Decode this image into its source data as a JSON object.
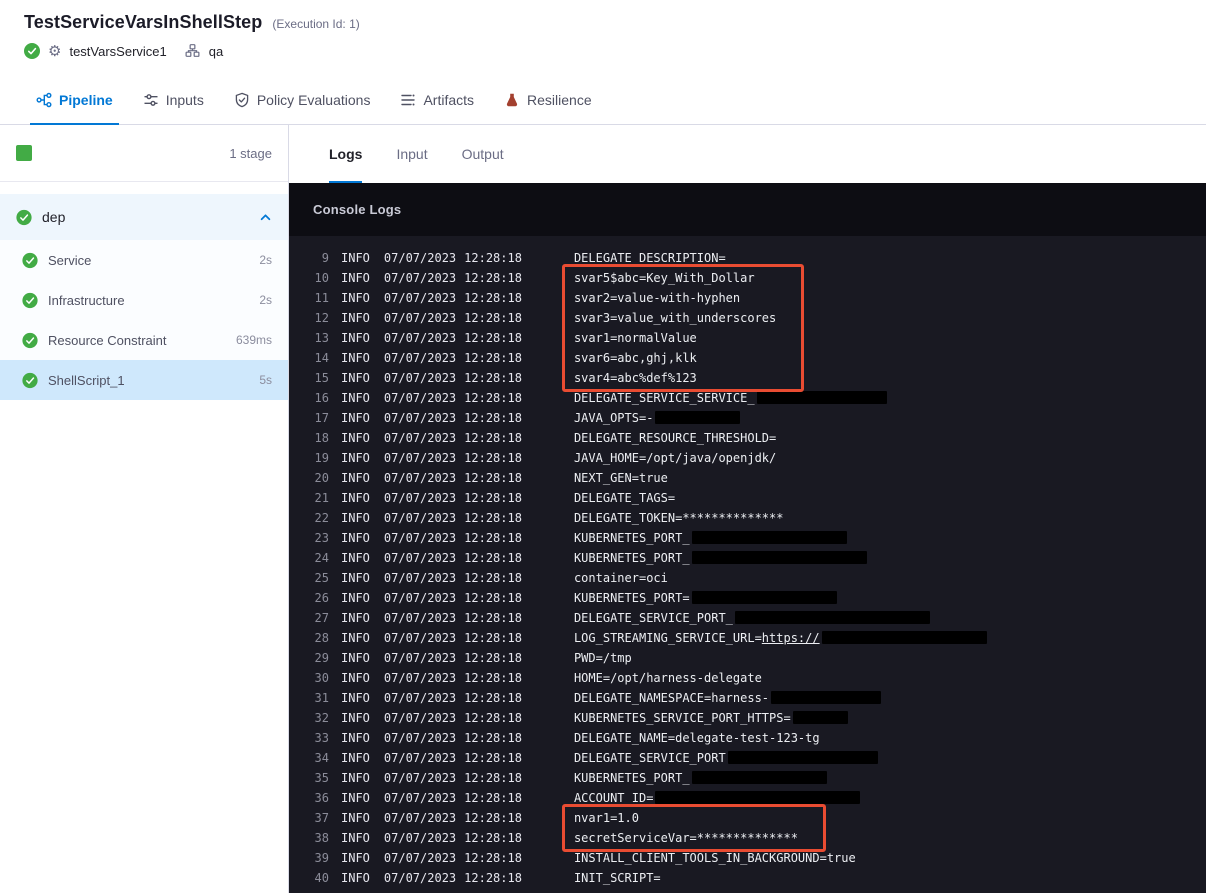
{
  "header": {
    "title": "TestServiceVarsInShellStep",
    "execution_id": "(Execution Id: 1)",
    "service_label": "testVarsService1",
    "env_label": "qa"
  },
  "nav_tabs": [
    {
      "label": "Pipeline",
      "icon": "pipeline-icon",
      "active": true
    },
    {
      "label": "Inputs",
      "icon": "inputs-icon",
      "active": false
    },
    {
      "label": "Policy Evaluations",
      "icon": "policy-icon",
      "active": false
    },
    {
      "label": "Artifacts",
      "icon": "artifacts-icon",
      "active": false
    },
    {
      "label": "Resilience",
      "icon": "resilience-icon",
      "active": false
    }
  ],
  "sidebar": {
    "stage_count_label": "1 stage",
    "stage_name": "dep",
    "steps": [
      {
        "name": "Service",
        "duration": "2s",
        "selected": false
      },
      {
        "name": "Infrastructure",
        "duration": "2s",
        "selected": false
      },
      {
        "name": "Resource Constraint",
        "duration": "639ms",
        "selected": false
      },
      {
        "name": "ShellScript_1",
        "duration": "5s",
        "selected": true
      }
    ]
  },
  "console": {
    "tabs": [
      {
        "label": "Logs",
        "active": true
      },
      {
        "label": "Input",
        "active": false
      },
      {
        "label": "Output",
        "active": false
      }
    ],
    "panel_title": "Console Logs",
    "log_level": "INFO",
    "log_date": "07/07/2023",
    "log_time": "12:28:18",
    "highlight_color": "#e94c32",
    "highlights": [
      {
        "from": 10,
        "to": 15
      },
      {
        "from": 37,
        "to": 38
      }
    ],
    "lines": [
      {
        "n": 9,
        "msg": "DELEGATE_DESCRIPTION="
      },
      {
        "n": 10,
        "msg": "svar5$abc=Key_With_Dollar"
      },
      {
        "n": 11,
        "msg": "svar2=value-with-hyphen"
      },
      {
        "n": 12,
        "msg": "svar3=value_with_underscores"
      },
      {
        "n": 13,
        "msg": "svar1=normalValue"
      },
      {
        "n": 14,
        "msg": "svar6=abc,ghj,klk"
      },
      {
        "n": 15,
        "msg": "svar4=abc%def%123"
      },
      {
        "n": 16,
        "msg": "DELEGATE_SERVICE_SERVICE_",
        "redact": 130
      },
      {
        "n": 17,
        "msg": "JAVA_OPTS=-",
        "redact": 85
      },
      {
        "n": 18,
        "msg": "DELEGATE_RESOURCE_THRESHOLD="
      },
      {
        "n": 19,
        "msg": "JAVA_HOME=/opt/java/openjdk/"
      },
      {
        "n": 20,
        "msg": "NEXT_GEN=true"
      },
      {
        "n": 21,
        "msg": "DELEGATE_TAGS="
      },
      {
        "n": 22,
        "msg": "DELEGATE_TOKEN=**************"
      },
      {
        "n": 23,
        "msg": "KUBERNETES_PORT_",
        "redact": 155
      },
      {
        "n": 24,
        "msg": "KUBERNETES_PORT_",
        "redact": 175
      },
      {
        "n": 25,
        "msg": "container=oci"
      },
      {
        "n": 26,
        "msg": "KUBERNETES_PORT=",
        "redact": 145
      },
      {
        "n": 27,
        "msg": "DELEGATE_SERVICE_PORT_",
        "redact": 195
      },
      {
        "n": 28,
        "msg": "LOG_STREAMING_SERVICE_URL=",
        "link": "https://",
        "redact": 165
      },
      {
        "n": 29,
        "msg": "PWD=/tmp"
      },
      {
        "n": 30,
        "msg": "HOME=/opt/harness-delegate"
      },
      {
        "n": 31,
        "msg": "DELEGATE_NAMESPACE=harness-",
        "redact": 110
      },
      {
        "n": 32,
        "msg": "KUBERNETES_SERVICE_PORT_HTTPS=",
        "redact": 55
      },
      {
        "n": 33,
        "msg": "DELEGATE_NAME=delegate-test-123-tg"
      },
      {
        "n": 34,
        "msg": "DELEGATE_SERVICE_PORT",
        "redact": 150
      },
      {
        "n": 35,
        "msg": "KUBERNETES_PORT_",
        "redact": 135
      },
      {
        "n": 36,
        "msg": "ACCOUNT_ID=",
        "redact": 205
      },
      {
        "n": 37,
        "msg": "nvar1=1.0"
      },
      {
        "n": 38,
        "msg": "secretServiceVar=**************"
      },
      {
        "n": 39,
        "msg": "INSTALL_CLIENT_TOOLS_IN_BACKGROUND=true"
      },
      {
        "n": 40,
        "msg": "INIT_SCRIPT="
      }
    ]
  },
  "colors": {
    "accent": "#0278d5",
    "success": "#42ab45",
    "console_bg": "#191922",
    "console_header_bg": "#0d0d13",
    "highlight": "#e94c32"
  }
}
